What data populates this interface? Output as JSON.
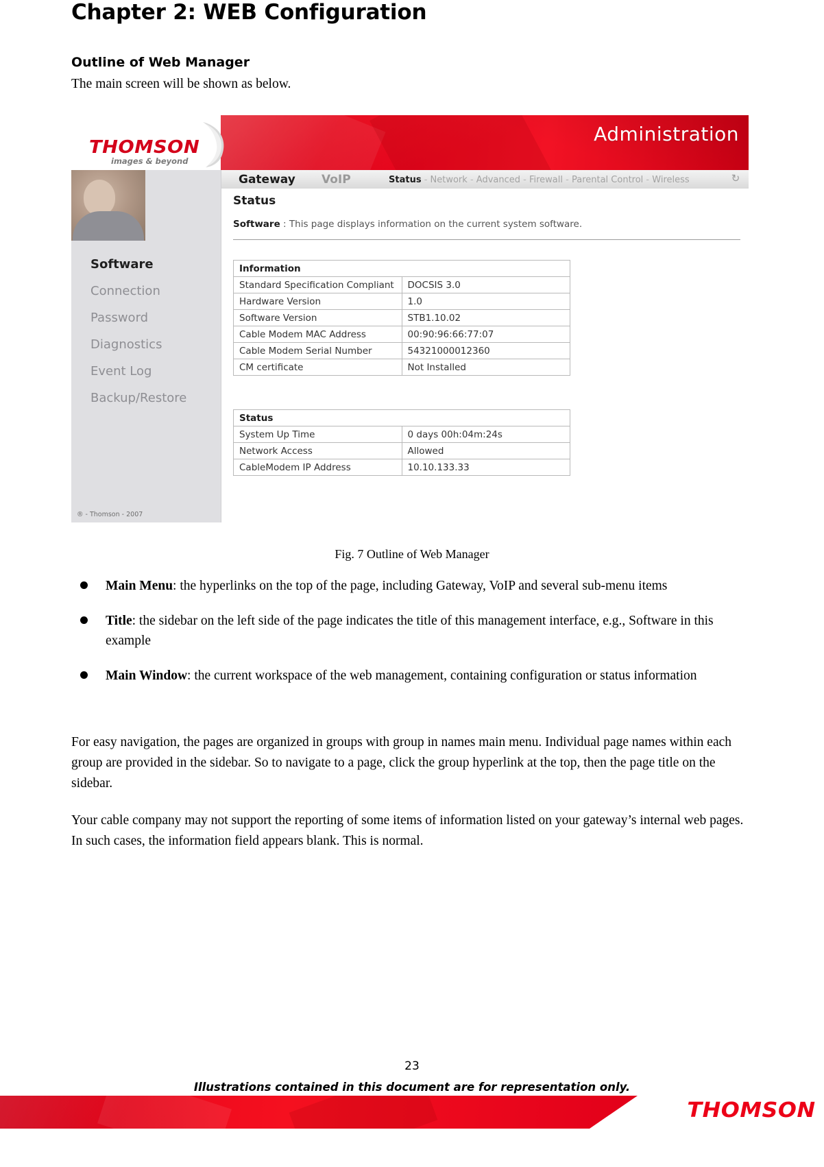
{
  "document": {
    "chapter_title": "Chapter 2: WEB Configuration",
    "section_heading": "Outline of Web Manager",
    "intro_line": "The main screen will be shown as below.",
    "figure_caption": "Fig. 7 Outline of Web Manager",
    "page_number": "23",
    "footer_note": "Illustrations contained in this document are for representation only.",
    "footer_brand": "THOMSON"
  },
  "screenshot": {
    "brand": {
      "logo_text": "THOMSON",
      "tagline": "images & beyond",
      "swoosh_icon": "swoosh-icon"
    },
    "header": {
      "page_title": "Administration"
    },
    "nav": {
      "primary": [
        {
          "label": "Gateway",
          "active": true
        },
        {
          "label": "VoIP",
          "active": false
        }
      ],
      "sub_items": [
        {
          "label": "Status",
          "active": true
        },
        {
          "label": "Network",
          "active": false
        },
        {
          "label": "Advanced",
          "active": false
        },
        {
          "label": "Firewall",
          "active": false
        },
        {
          "label": "Parental Control",
          "active": false
        },
        {
          "label": "Wireless",
          "active": false
        }
      ],
      "separator": "-",
      "refresh_icon": "refresh-icon"
    },
    "sidebar": {
      "items": [
        {
          "label": "Software",
          "selected": true
        },
        {
          "label": "Connection",
          "selected": false
        },
        {
          "label": "Password",
          "selected": false
        },
        {
          "label": "Diagnostics",
          "selected": false
        },
        {
          "label": "Event Log",
          "selected": false
        },
        {
          "label": "Backup/Restore",
          "selected": false
        }
      ],
      "copyright": "® - Thomson - 2007"
    },
    "main": {
      "title": "Status",
      "desc_label": "Software",
      "desc_separator": ":",
      "desc_text": "This page displays information on the current system software.",
      "information_table": {
        "caption": "Information",
        "rows": [
          {
            "key": "Standard Specification Compliant",
            "value": "DOCSIS 3.0"
          },
          {
            "key": "Hardware Version",
            "value": "1.0"
          },
          {
            "key": "Software Version",
            "value": "STB1.10.02"
          },
          {
            "key": "Cable Modem MAC Address",
            "value": "00:90:96:66:77:07"
          },
          {
            "key": "Cable Modem Serial Number",
            "value": "54321000012360"
          },
          {
            "key": "CM certificate",
            "value": "Not Installed"
          }
        ]
      },
      "status_table": {
        "caption": "Status",
        "rows": [
          {
            "key": "System Up Time",
            "value": "0 days 00h:04m:24s"
          },
          {
            "key": "Network Access",
            "value": "Allowed"
          },
          {
            "key": "CableModem IP Address",
            "value": "10.10.133.33"
          }
        ]
      }
    }
  },
  "bullets": [
    {
      "term": "Main Menu",
      "text": ": the hyperlinks on the top of the page, including Gateway, VoIP and several sub-menu items"
    },
    {
      "term": "Title",
      "text": ": the sidebar on the left side of the page indicates the title of this management interface, e.g., Software in this example"
    },
    {
      "term": "Main Window",
      "text": ": the current workspace of the web management, containing configuration or status information"
    }
  ],
  "paragraphs": {
    "p1": "For easy navigation, the pages are organized in groups with group in names main menu. Individual page names within each group are provided in the sidebar. So to navigate to a page, click the group hyperlink at the top, then the page title on the sidebar.",
    "p2": "Your cable company may not support the reporting of some items of information listed on your gateway’s internal web pages. In such cases, the information field appears blank. This is normal."
  },
  "colors": {
    "brand_red": "#d4001a",
    "band_red": "#e2001a"
  }
}
